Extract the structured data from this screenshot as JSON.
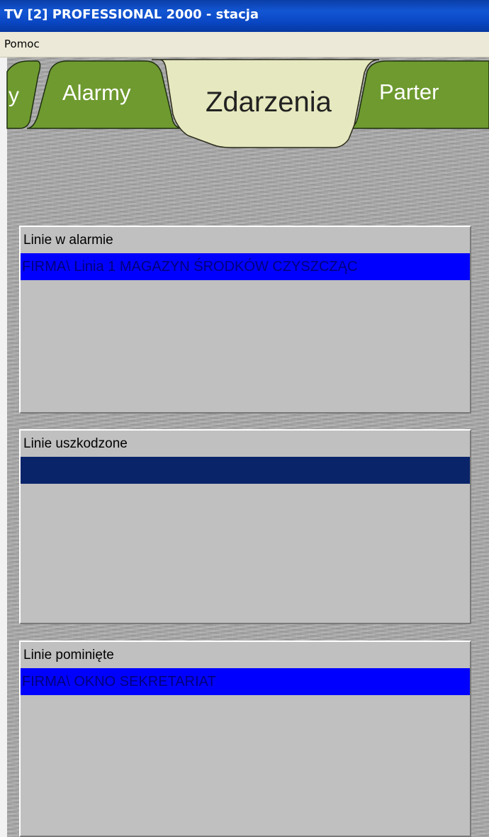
{
  "window": {
    "title": "TV [2] PROFESSIONAL 2000 - stacja"
  },
  "menu": {
    "items": [
      "Pomoc"
    ]
  },
  "tabs": [
    {
      "label": "y",
      "active": false
    },
    {
      "label": "Alarmy",
      "active": false
    },
    {
      "label": "Zdarzenia",
      "active": true
    },
    {
      "label": "Parter",
      "active": false
    }
  ],
  "panels": [
    {
      "title": "Linie w alarmie",
      "rows": [
        "FIRMA\\ Linia 1 MAGAZYN ŚRODKÓW CZYSZCZĄC"
      ]
    },
    {
      "title": "Linie uszkodzone",
      "rows": [
        ""
      ]
    },
    {
      "title": "Linie pominięte",
      "rows": [
        "FIRMA\\ OKNO SEKRETARIAT"
      ]
    }
  ],
  "colors": {
    "titlebar": "#0a46c3",
    "tab_green": "#6e9a2f",
    "tab_active": "#e6e8bf",
    "selected_row_blue": "#0000ff",
    "selected_row_navy": "#0a246a",
    "panel_bg": "#c0c0c0"
  }
}
